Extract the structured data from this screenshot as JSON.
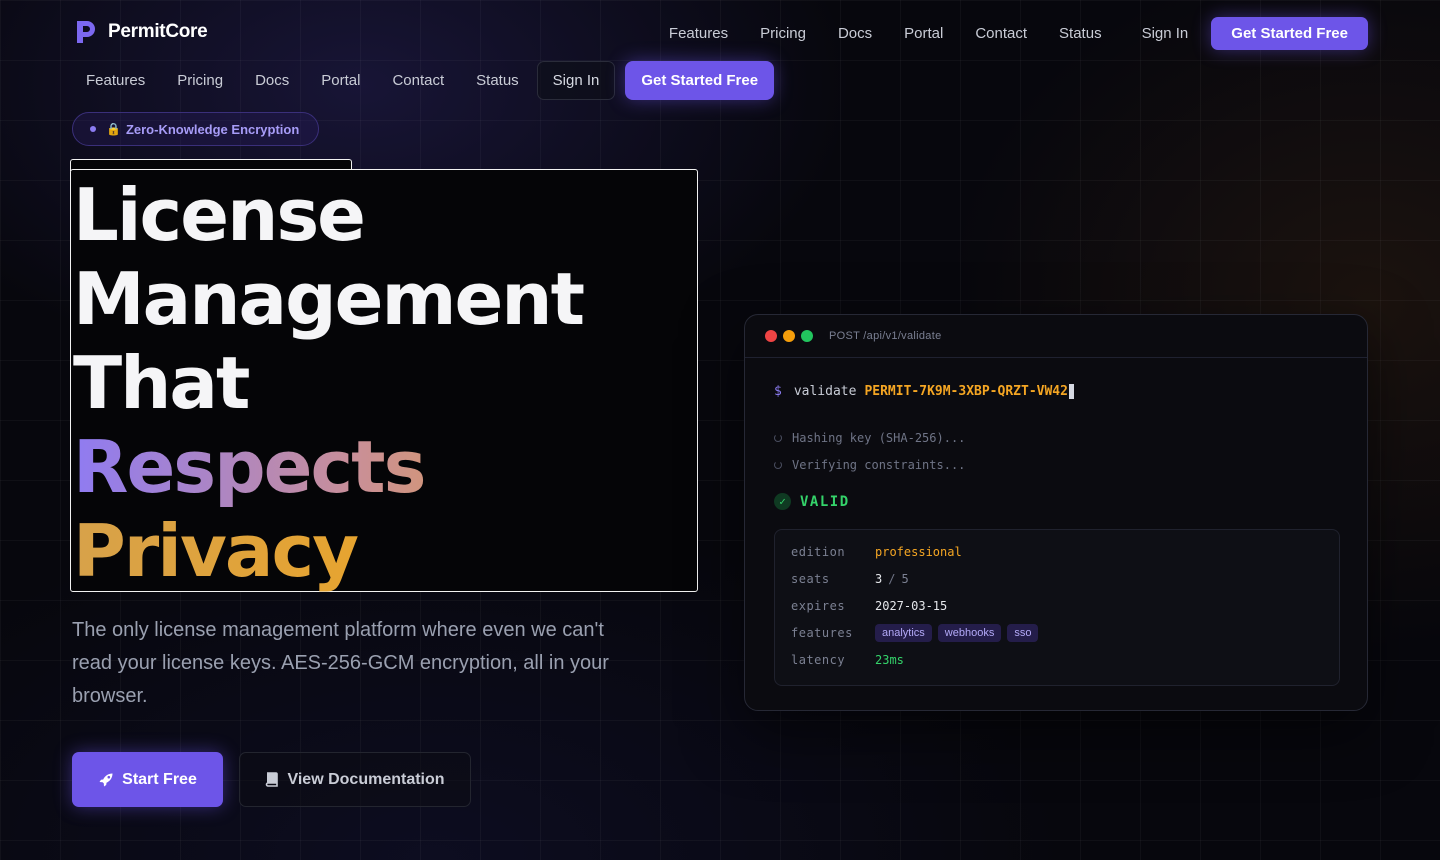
{
  "brand": {
    "name": "PermitCore",
    "logo_icon": "permitcore-p-logo",
    "accent": "#6d55e8"
  },
  "top_nav": {
    "links": [
      "Features",
      "Pricing",
      "Docs",
      "Portal",
      "Contact",
      "Status"
    ],
    "sign_in": "Sign In",
    "cta": "Get Started Free"
  },
  "sub_nav": {
    "links": [
      "Features",
      "Pricing",
      "Docs",
      "Portal",
      "Contact",
      "Status"
    ],
    "sign_in": "Sign In",
    "cta": "Get Started Free"
  },
  "badge": {
    "icon": "lock-icon",
    "text": "Zero-Knowledge Encryption"
  },
  "headline": {
    "line1": "License",
    "line2": "Management",
    "line3": "That",
    "line4": "Respects",
    "line5": "Privacy"
  },
  "description": "The only license management platform where even we can't read your license keys. AES-256-GCM encryption, all in your browser.",
  "cta": {
    "start": {
      "label": "Start Free",
      "icon": "rocket-icon"
    },
    "docs": {
      "label": "View Documentation",
      "icon": "book-icon"
    }
  },
  "terminal": {
    "title": "POST /api/v1/validate",
    "prompt": "$",
    "command": "validate",
    "license_key": "PERMIT-7K9M-3XBP-QRZT-VW42",
    "steps": [
      "Hashing key (SHA-256)...",
      "Verifying constraints..."
    ],
    "status": "VALID",
    "result": {
      "edition": {
        "key": "edition",
        "value": "professional"
      },
      "seats": {
        "key": "seats",
        "used": "3",
        "separator": "/",
        "total": "5"
      },
      "expires": {
        "key": "expires",
        "value": "2027-03-15"
      },
      "features": {
        "key": "features",
        "tags": [
          "analytics",
          "webhooks",
          "sso"
        ]
      },
      "latency": {
        "key": "latency",
        "value": "23ms"
      }
    }
  }
}
